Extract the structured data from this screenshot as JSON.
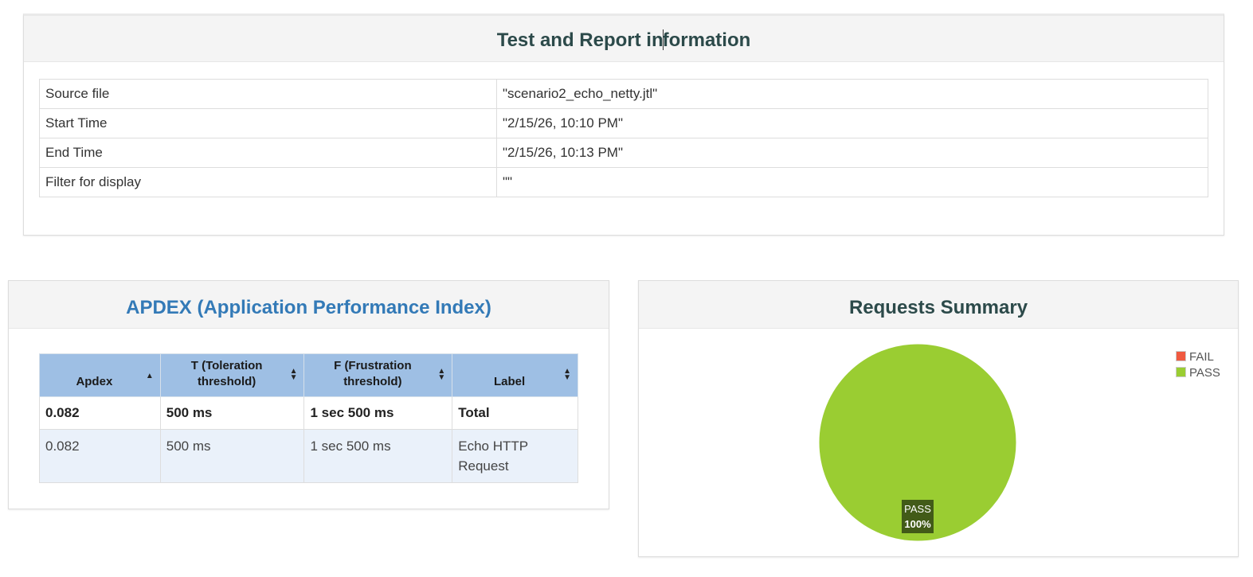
{
  "info": {
    "title_part1": "Test and Report in",
    "title_part2": "formation",
    "rows": [
      {
        "key": "Source file",
        "value": "\"scenario2_echo_netty.jtl\""
      },
      {
        "key": "Start Time",
        "value": "\"2/15/26, 10:10 PM\""
      },
      {
        "key": "End Time",
        "value": "\"2/15/26, 10:13 PM\""
      },
      {
        "key": "Filter for display",
        "value": "\"\""
      }
    ]
  },
  "apdex": {
    "title": "APDEX (Application Performance Index)",
    "headers": {
      "apdex": "Apdex",
      "t_line1": "T (Toleration",
      "t_line2": "threshold)",
      "f_line1": "F (Frustration",
      "f_line2": "threshold)",
      "label": "Label"
    },
    "total": {
      "apdex": "0.082",
      "t": "500 ms",
      "f": "1 sec 500 ms",
      "label": "Total"
    },
    "rows": [
      {
        "apdex": "0.082",
        "t": "500 ms",
        "f": "1 sec 500 ms",
        "label": "Echo HTTP Request"
      }
    ]
  },
  "summary": {
    "title": "Requests Summary",
    "legend": [
      {
        "label": "FAIL",
        "color": "#f05a40"
      },
      {
        "label": "PASS",
        "color": "#9acd32"
      }
    ]
  },
  "chart_data": {
    "type": "pie",
    "title": "Requests Summary",
    "series": [
      {
        "name": "FAIL",
        "value": 0,
        "color": "#f05a40"
      },
      {
        "name": "PASS",
        "value": 100,
        "color": "#9acd32"
      }
    ],
    "data_labels": [
      {
        "name": "PASS",
        "text": "100%"
      }
    ],
    "legend_position": "top-right"
  }
}
